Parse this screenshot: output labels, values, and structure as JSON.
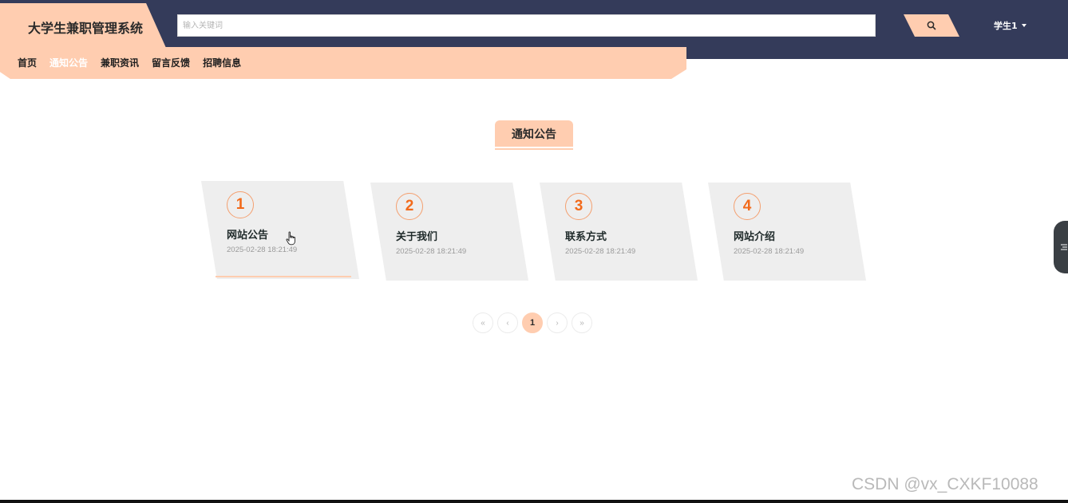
{
  "app": {
    "title": "大学生兼职管理系统"
  },
  "search": {
    "placeholder": "输入关键词"
  },
  "user": {
    "name": "学生1"
  },
  "nav": {
    "items": [
      {
        "label": "首页",
        "active": false
      },
      {
        "label": "通知公告",
        "active": true
      },
      {
        "label": "兼职资讯",
        "active": false
      },
      {
        "label": "留言反馈",
        "active": false
      },
      {
        "label": "招聘信息",
        "active": false
      }
    ]
  },
  "section": {
    "title": "通知公告"
  },
  "notices": [
    {
      "number": "1",
      "title": "网站公告",
      "time": "2025-02-28 18:21:49"
    },
    {
      "number": "2",
      "title": "关于我们",
      "time": "2025-02-28 18:21:49"
    },
    {
      "number": "3",
      "title": "联系方式",
      "time": "2025-02-28 18:21:49"
    },
    {
      "number": "4",
      "title": "网站介绍",
      "time": "2025-02-28 18:21:49"
    }
  ],
  "pagination": {
    "first": "«",
    "prev": "‹",
    "current": "1",
    "next": "›",
    "last": "»"
  },
  "watermark": "CSDN @vx_CXKF10088",
  "colors": {
    "header_bg": "#343b5a",
    "accent": "#ffcdb0",
    "number": "#f26a1b",
    "card_bg": "#eeeeee"
  },
  "icons": {
    "search": "search-icon",
    "caret": "caret-down-icon",
    "cursor": "hand-pointer-icon",
    "side": "menu-icon"
  }
}
